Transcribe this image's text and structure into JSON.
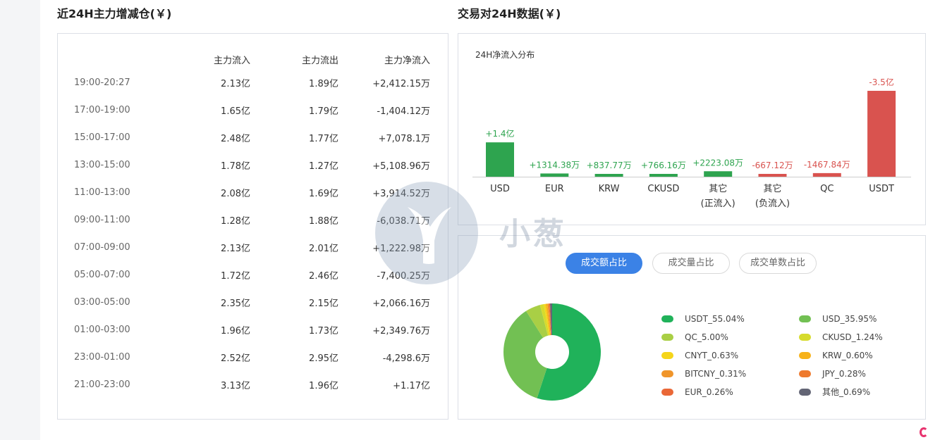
{
  "left_title": "近24H主力增减仓(￥)",
  "right_title": "交易对24H数据(￥)",
  "flow_table": {
    "headers": [
      "",
      "主力流入",
      "主力流出",
      "主力净流入"
    ],
    "rows": [
      {
        "time": "19:00-20:27",
        "in": "2.13亿",
        "out": "1.89亿",
        "net": "+2,412.15万",
        "sign": "pos"
      },
      {
        "time": "17:00-19:00",
        "in": "1.65亿",
        "out": "1.79亿",
        "net": "-1,404.12万",
        "sign": "neg"
      },
      {
        "time": "15:00-17:00",
        "in": "2.48亿",
        "out": "1.77亿",
        "net": "+7,078.1万",
        "sign": "pos"
      },
      {
        "time": "13:00-15:00",
        "in": "1.78亿",
        "out": "1.27亿",
        "net": "+5,108.96万",
        "sign": "pos"
      },
      {
        "time": "11:00-13:00",
        "in": "2.08亿",
        "out": "1.69亿",
        "net": "+3,914.52万",
        "sign": "pos"
      },
      {
        "time": "09:00-11:00",
        "in": "1.28亿",
        "out": "1.88亿",
        "net": "-6,038.71万",
        "sign": "neg"
      },
      {
        "time": "07:00-09:00",
        "in": "2.13亿",
        "out": "2.01亿",
        "net": "+1,222.98万",
        "sign": "pos"
      },
      {
        "time": "05:00-07:00",
        "in": "1.72亿",
        "out": "2.46亿",
        "net": "-7,400.25万",
        "sign": "neg"
      },
      {
        "time": "03:00-05:00",
        "in": "2.35亿",
        "out": "2.15亿",
        "net": "+2,066.16万",
        "sign": "pos"
      },
      {
        "time": "01:00-03:00",
        "in": "1.96亿",
        "out": "1.73亿",
        "net": "+2,349.76万",
        "sign": "pos"
      },
      {
        "time": "23:00-01:00",
        "in": "2.52亿",
        "out": "2.95亿",
        "net": "-4,298.6万",
        "sign": "neg"
      },
      {
        "time": "21:00-23:00",
        "in": "3.13亿",
        "out": "1.96亿",
        "net": "+1.17亿",
        "sign": "pos"
      }
    ]
  },
  "tabs": [
    "成交额占比",
    "成交量占比",
    "成交单数占比"
  ],
  "active_tab": 0,
  "watermark": "小葱",
  "colors": {
    "positive": "#2ea44f",
    "negative": "#d9534f",
    "accent": "#3b82e6"
  },
  "chart_data": [
    {
      "type": "bar",
      "title": "24H净流入分布",
      "unit": "万",
      "categories": [
        "USD",
        "EUR",
        "KRW",
        "CKUSD",
        "其它\n(正流入)",
        "其它\n(负流入)",
        "QC",
        "USDT"
      ],
      "values": [
        14000,
        1314.38,
        837.77,
        766.16,
        2223.08,
        -667.12,
        -1467.84,
        -35000
      ],
      "data_labels": [
        "+1.4亿",
        "+1314.38万",
        "+837.77万",
        "+766.16万",
        "+2223.08万",
        "-667.12万",
        "-1467.84万",
        "-3.5亿"
      ],
      "note": "bar heights use absolute value; green for positive, red for negative"
    },
    {
      "type": "pie",
      "donut": true,
      "slices": [
        {
          "label": "USDT",
          "value": 55.04,
          "color": "#20b25a"
        },
        {
          "label": "USD",
          "value": 35.95,
          "color": "#72c053"
        },
        {
          "label": "QC",
          "value": 5.0,
          "color": "#a9cf45"
        },
        {
          "label": "CKUSD",
          "value": 1.24,
          "color": "#d6db2c"
        },
        {
          "label": "CNYT",
          "value": 0.63,
          "color": "#f5d51a"
        },
        {
          "label": "KRW",
          "value": 0.6,
          "color": "#f7b219"
        },
        {
          "label": "BITCNY",
          "value": 0.31,
          "color": "#f0952a"
        },
        {
          "label": "JPY",
          "value": 0.28,
          "color": "#ee7a2e"
        },
        {
          "label": "EUR",
          "value": 0.26,
          "color": "#ea6837"
        },
        {
          "label": "其他",
          "value": 0.69,
          "color": "#636575"
        }
      ],
      "legend_labels": [
        "USDT_55.04%",
        "USD_35.95%",
        "QC_5.00%",
        "CKUSD_1.24%",
        "CNYT_0.63%",
        "KRW_0.60%",
        "BITCNY_0.31%",
        "JPY_0.28%",
        "EUR_0.26%",
        "其他_0.69%"
      ]
    }
  ]
}
